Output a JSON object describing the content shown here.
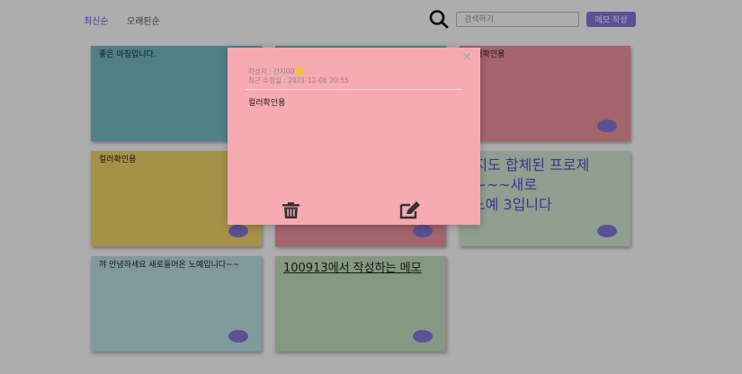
{
  "colors": {
    "accent": "#8677dc",
    "modal_bg": "#f7aab1",
    "card_teal": "#78bcc9",
    "card_green": "#7fc79d",
    "card_rose": "#f0949f",
    "card_yellow": "#f6d66c",
    "card_mint": "#d3ead4",
    "card_light_teal": "#bfe3e6",
    "card_light_green": "#c4e0bf"
  },
  "header": {
    "sort_tabs": [
      {
        "label": "최신순",
        "active": true
      },
      {
        "label": "오래된순",
        "active": false
      }
    ],
    "search": {
      "placeholder": "검색하기",
      "value": ""
    },
    "write_button_label": "메모 작성",
    "search_icon": "search-icon"
  },
  "cards": [
    {
      "text": "좋은 아침입니다."
    },
    {
      "text": ""
    },
    {
      "text": "컬러확인용"
    },
    {
      "text": "컬러확인용"
    },
    {
      "text": ""
    },
    {
      "text_lines": [
        "~지도 합체된 프로제",
        "~~~~새로",
        "- 노예 3입니다"
      ]
    },
    {
      "text": "꺄 안녕하세요 새로들어온 노예입니다~~"
    },
    {
      "text": "100913에서 작성하는 메모"
    },
    {
      "text": ""
    }
  ],
  "modal": {
    "author_label": "작성자 : 간지00",
    "modified_label": "최근 수정일 : 2021-12-06 20:55",
    "body": "컬러확인용",
    "close_icon": "close-icon",
    "delete_icon": "trash-icon",
    "edit_icon": "edit-icon"
  }
}
